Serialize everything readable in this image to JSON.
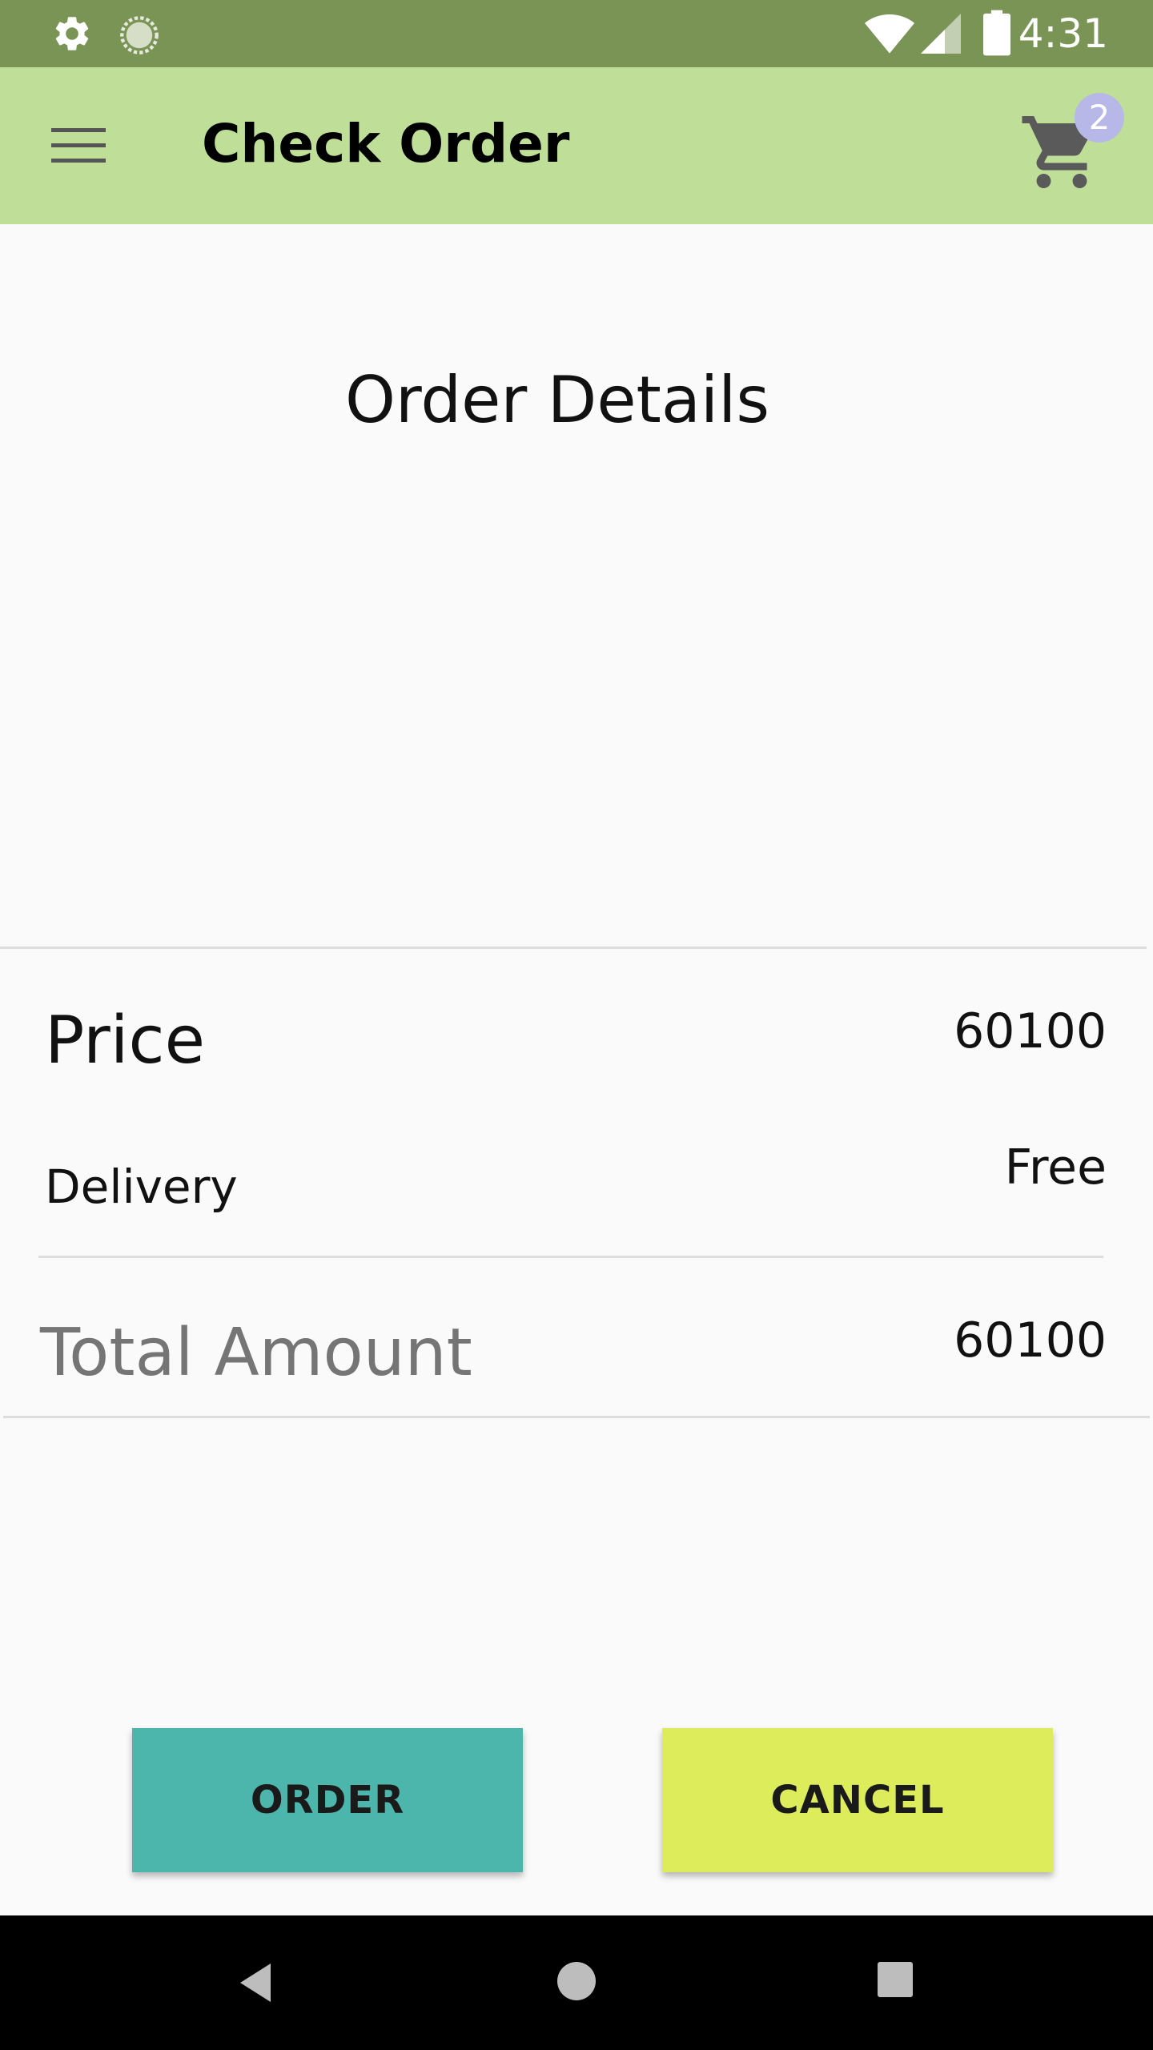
{
  "status_bar": {
    "time": "4:31",
    "icons": [
      "gear-icon",
      "sync-icon",
      "wifi-icon",
      "signal-icon",
      "battery-icon"
    ]
  },
  "app_bar": {
    "title": "Check Order",
    "menu_icon": "menu-icon",
    "cart_icon": "cart-icon",
    "cart_count": "2"
  },
  "main": {
    "section_title": "Order Details",
    "price_label": "Price",
    "price_value": "60100",
    "delivery_label": "Delivery",
    "delivery_value": "Free",
    "total_label": "Total Amount",
    "total_value": "60100"
  },
  "actions": {
    "order_label": "ORDER",
    "cancel_label": "CANCEL"
  },
  "nav_bar": {
    "icons": [
      "back-icon",
      "home-icon",
      "recents-icon"
    ]
  },
  "colors": {
    "status_bar": "#7A9455",
    "app_bar": "#BFDF99",
    "order_button": "#4DB6AC",
    "cancel_button": "#DCEC5A",
    "badge": "#B7B8E8",
    "background": "#FAFAFA"
  }
}
